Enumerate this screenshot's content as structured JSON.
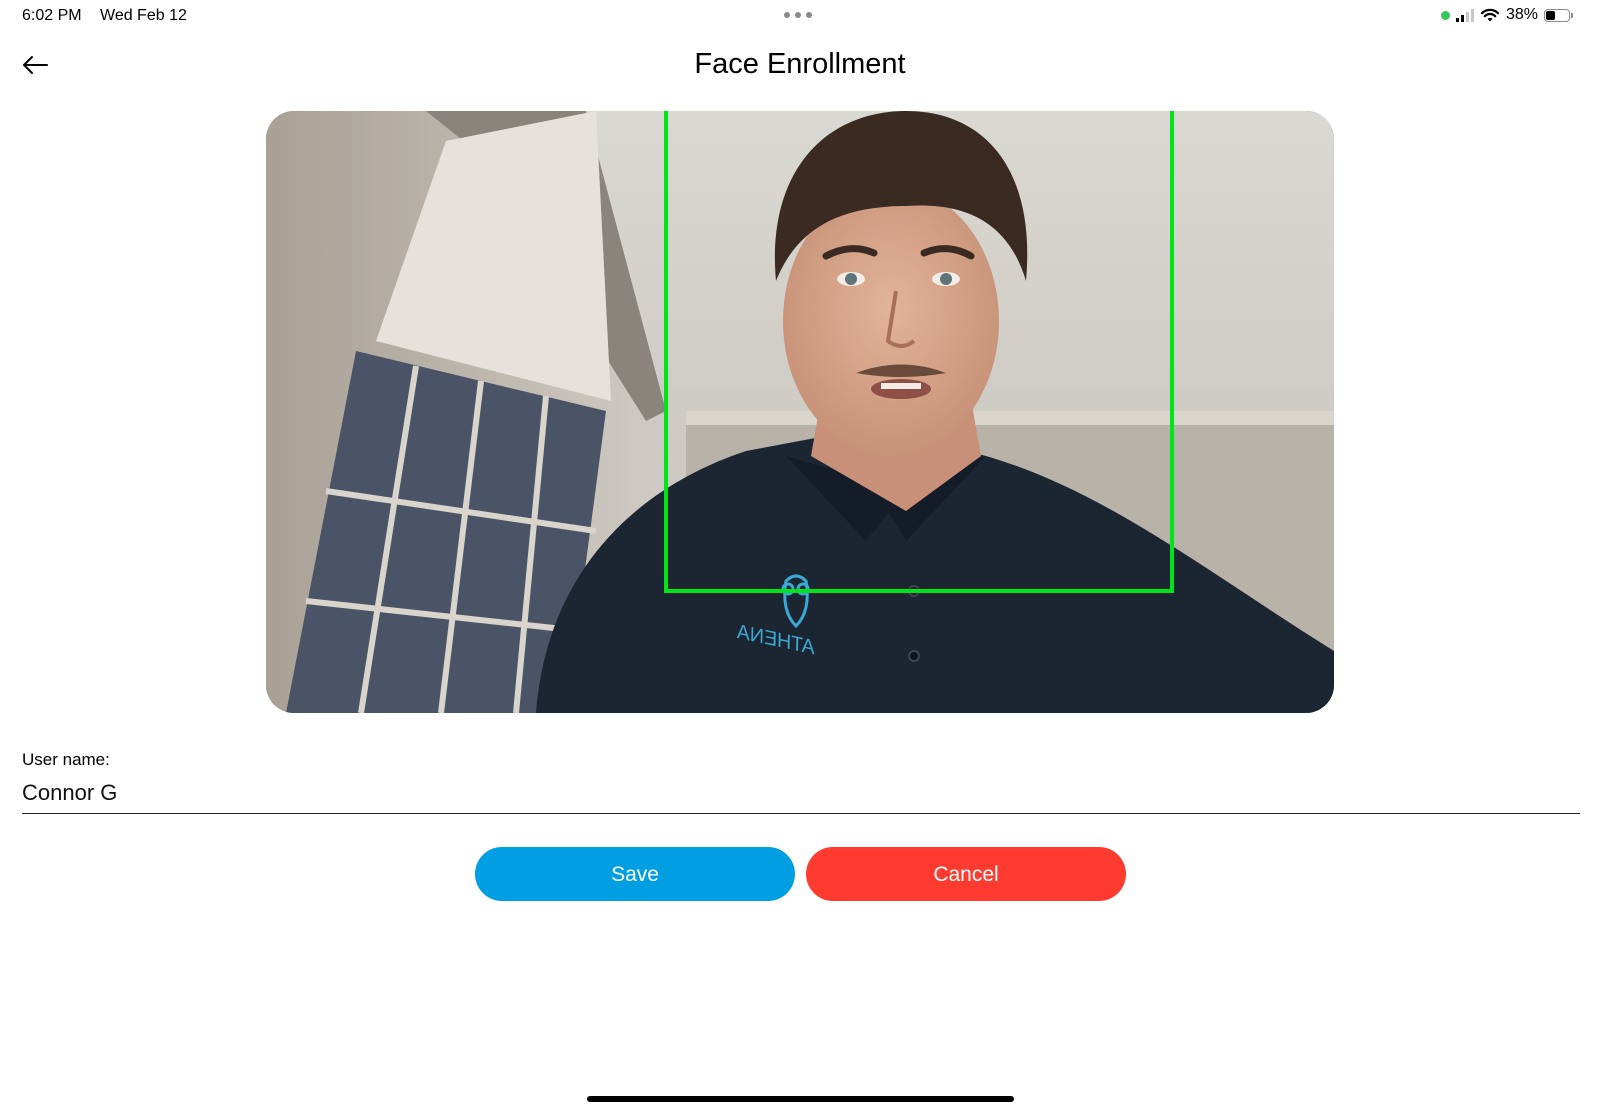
{
  "status_bar": {
    "time": "6:02 PM",
    "date": "Wed Feb 12",
    "battery": "38%",
    "battery_level": 0.38
  },
  "header": {
    "title": "Face Enrollment",
    "back_icon": "arrow-left-icon"
  },
  "camera": {
    "shirt_logo_text": "ATHENA",
    "face_box_color": "#00e51a"
  },
  "form": {
    "username_label": "User name:",
    "username_value": "Connor G"
  },
  "actions": {
    "save_label": "Save",
    "cancel_label": "Cancel",
    "save_color": "#009fe3",
    "cancel_color": "#ff3b30"
  }
}
